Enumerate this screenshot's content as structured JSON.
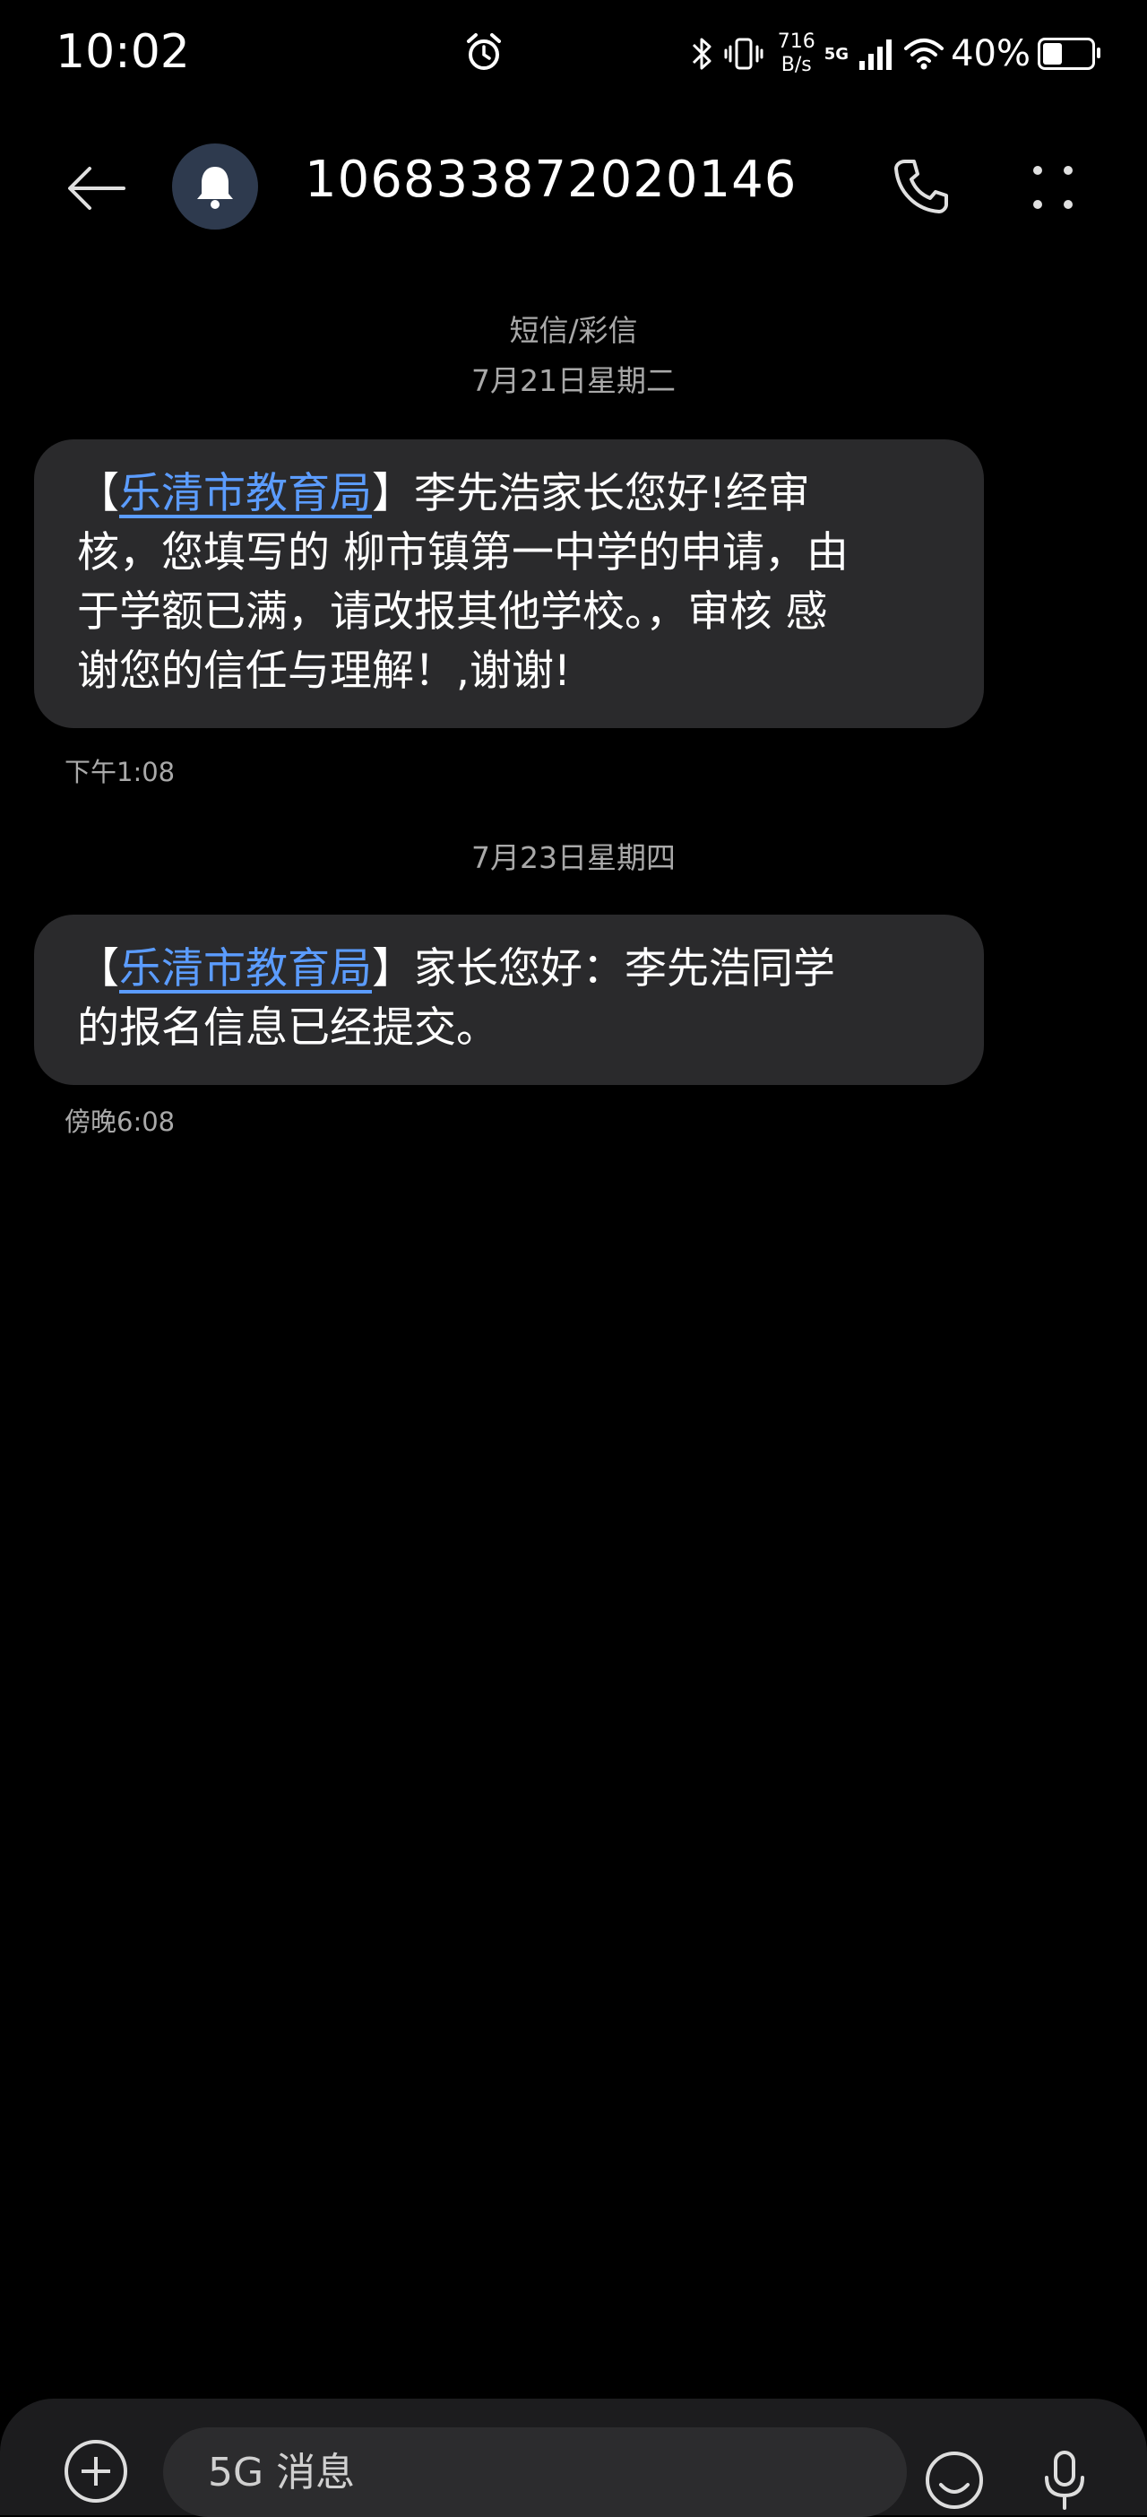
{
  "status_bar": {
    "time": "10:02",
    "net_speed_value": "716",
    "net_speed_unit": "B/s",
    "network": "5G",
    "battery_text": "40%",
    "battery_level": 0.4
  },
  "header": {
    "contact_number": "106833872020146"
  },
  "conversation": {
    "channel_label": "短信/彩信",
    "messages": [
      {
        "date": "7月21日星期二",
        "sender_tag": "乐清市教育局",
        "line1_rest": "李先浩家长您好!经审",
        "line2": "核，您填写的 柳市镇第一中学的申请，由",
        "line3": "于学额已满，请改报其他学校。，审核 感",
        "line4": "谢您的信任与理解！,谢谢!",
        "time": "下午1:08"
      },
      {
        "date": "7月23日星期四",
        "sender_tag": "乐清市教育局",
        "line1_rest": "家长您好：李先浩同学",
        "line2": "的报名信息已经提交。",
        "time": "傍晚6:08"
      }
    ]
  },
  "composer": {
    "placeholder": "5G 消息"
  },
  "icons": [
    "alarm-icon",
    "bluetooth-icon",
    "vibrate-icon",
    "signal-icon",
    "wifi-icon",
    "battery-icon",
    "back-arrow-icon",
    "bell-icon",
    "phone-icon",
    "more-icon",
    "add-icon",
    "emoji-icon",
    "microphone-icon"
  ]
}
